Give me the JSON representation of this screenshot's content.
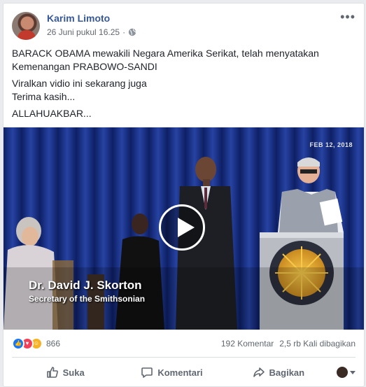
{
  "post": {
    "author": "Karim Limoto",
    "timestamp": "26 Juni pukul 16.25",
    "separator": "·",
    "privacy_icon": "globe-icon",
    "more_icon": "more-options-icon",
    "more_label": "•••",
    "paragraphs": [
      "BARACK OBAMA mewakili Negara Amerika Serikat, telah menyatakan Kemenangan PRABOWO-SANDI",
      "Viralkan vidio ini sekarang juga",
      "Terima kasih...",
      "ALLAHUAKBAR..."
    ]
  },
  "video": {
    "date_stamp": "FEB 12, 2018",
    "lower_third_name": "Dr. David J. Skorton",
    "lower_third_title": "Secretary of the Smithsonian",
    "seal_text": "SMITHSONIAN INSTITUTION",
    "play_icon": "play-icon"
  },
  "stats": {
    "reaction_icons": [
      "like-reaction-icon",
      "love-reaction-icon",
      "haha-reaction-icon"
    ],
    "reaction_count": "866",
    "comments": "192 Komentar",
    "shares": "2,5 rb Kali dibagikan"
  },
  "actions": {
    "like": "Suka",
    "comment": "Komentari",
    "share": "Bagikan"
  },
  "colors": {
    "link": "#365899",
    "video_bg": "#152b7a",
    "like": "#1877f2",
    "love": "#f33e58",
    "haha": "#f7b125"
  }
}
